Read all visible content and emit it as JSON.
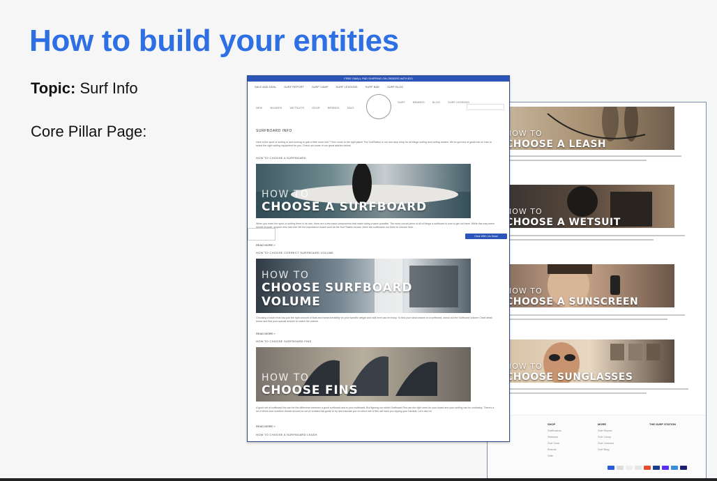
{
  "slide": {
    "title": "How to build your entities",
    "topic_label": "Topic:",
    "topic_value": " Surf Info",
    "pillar_label": "Core Pillar Page:"
  },
  "front_page": {
    "announcement": "FREE SMALL PAD SHIPPING ON ORDERS WITH $70",
    "top_nav": [
      "SALE AND DEAL",
      "SURF REPORT",
      "SURF CAMP",
      "SURF LESSONS",
      "SURF BAR",
      "SURF BLOG"
    ],
    "main_menu": [
      "NEW",
      "BOARDS",
      "WETSUITS",
      "GEAR",
      "BRANDS",
      "SALE"
    ],
    "main_menu_right": [
      "SURF",
      "BRANDS",
      "BLOG",
      "SURF LESSONS"
    ],
    "page_title": "SURFBOARD INFO",
    "intro": "Here is the sport of surfing or and looking to gain a little more info? Then come to the right place! The SurfStation is our one-stop shop for all things surfing and surfing related. We've got tons of great info on how to select the right surfing equipment for you. Check out some of our great articles below!",
    "sections": [
      {
        "sub": "HOW TO CHOOSE A SURFBOARD",
        "howto": "HOW TO",
        "caption": "CHOOSE A SURFBOARD",
        "text": "When you enter the sport of surfing there is its own, there are a few basic components that make riding a wave possible. The most crucial piece of all of things a surfboard is how to get out there. While this may seem simple enough, anyone who has ever felt the importance board such as the Surf Station knows, there are surfboards out there to choose from.",
        "read": "READ MORE »"
      },
      {
        "sub": "HOW TO CHOOSE CORRECT SURFBOARD VOLUME",
        "howto": "HOW TO",
        "caption": "CHOOSE SURFBOARD VOLUME",
        "text": "Choosing a board that has just the right amount of float and maneuverability for your specific weight and skill level can be tricky. To find your ideal volume in a surfboard, check out the Surfboard Volume Chart detail below and find your special answer to match the volume.",
        "read": "READ MORE »"
      },
      {
        "sub": "HOW TO CHOOSE SURFBOARD FINS",
        "howto": "HOW TO",
        "caption": "CHOOSE FINS",
        "text": "A good set of surfboard fins can be the difference between a good surfboard and to your surfboard. But figuring out which Surfboard Fins are the right ones for your board and your surfing can be confusing. There's a lot of terms and numbers thrown around so we've created this guide to try and educate you on which set of fins will have you ripping your hardest. Let's dive in!",
        "read": "READ MORE »"
      }
    ],
    "last_sub": "HOW TO CHOOSE A SURFBOARD LEASH",
    "chat_button": "Chat With Us Now!"
  },
  "back_page": {
    "sections": [
      {
        "howto": "HOW TO",
        "caption": "CHOOSE A LEASH"
      },
      {
        "howto": "HOW TO",
        "caption": "CHOOSE A WETSUIT"
      },
      {
        "howto": "HOW TO",
        "caption": "CHOOSE A SUNSCREEN"
      },
      {
        "howto": "HOW TO",
        "caption": "CHOOSE SUNGLASSES"
      }
    ],
    "footer": {
      "shop": {
        "title": "SHOP",
        "items": [
          "Surfboards",
          "Wetsuits",
          "Surf Gear",
          "Brands",
          "Sale"
        ]
      },
      "more": {
        "title": "MORE",
        "items": [
          "Surf Report",
          "Surf Camp",
          "Surf Lessons",
          "Surf Blog"
        ]
      },
      "about": {
        "title": "THE SURF STATION"
      }
    }
  },
  "colors": {
    "title_blue": "#2f6fe4",
    "announcement_bar": "#2b55b8"
  }
}
